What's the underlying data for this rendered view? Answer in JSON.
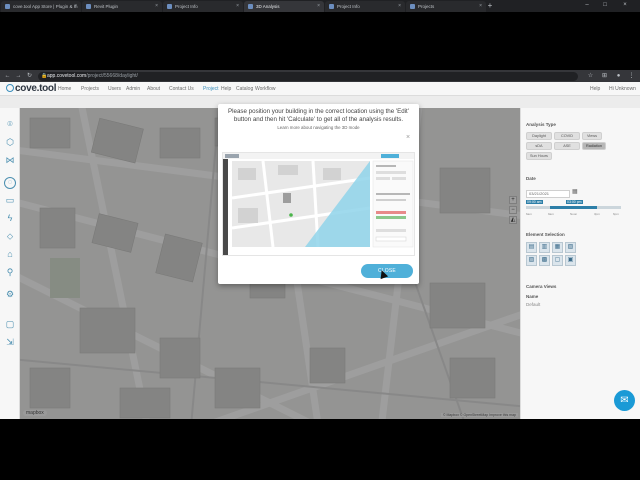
{
  "browser": {
    "tabs": [
      {
        "label": "cove.tool App Store | Plugin & In"
      },
      {
        "label": "Revit Plugin"
      },
      {
        "label": "Project Info"
      },
      {
        "label": "3D Analysis",
        "active": true
      },
      {
        "label": "Project Info"
      },
      {
        "label": "Projects"
      }
    ],
    "new_tab": "+",
    "url_host": "app.covetool.com",
    "url_path": "/project/55668/daylight/",
    "window_buttons": [
      "–",
      "□",
      "×"
    ]
  },
  "app": {
    "logo": "cove.tool",
    "nav": [
      "Home",
      "Projects",
      "Users",
      "Admin",
      "About",
      "Contact Us"
    ],
    "nav_project": [
      "Project",
      "Help",
      "Catalog",
      "Workflow"
    ],
    "help": "Help",
    "user": "Hi Unknown"
  },
  "left_tools": [
    "map-pin",
    "cube",
    "share",
    "circle",
    "folder",
    "bolt",
    "droplet",
    "tag",
    "person",
    "gear",
    "chat",
    "export"
  ],
  "map": {
    "attribution": "© Mapbox © OpenStreetMap Improve this map",
    "logo": "mapbox",
    "zoom_in": "+",
    "zoom_out": "−"
  },
  "right_panel": {
    "analysis_type_title": "Analysis Type",
    "analysis_types": [
      "Daylight",
      "COVID",
      "Views",
      "sDA",
      "ASE",
      "Radiation",
      "Sun Hours"
    ],
    "selected_analysis": "Radiation",
    "date_title": "Date",
    "date_value": "03/21/2021",
    "time_start": "09:00 am",
    "time_end": "03:00 pm",
    "time_ticks": [
      "6am",
      "9am",
      "Noon",
      "3pm",
      "6pm"
    ],
    "time_range_fraction": [
      0.25,
      0.75
    ],
    "element_selection_title": "Element Selection",
    "camera_views_title": "Camera Views",
    "name_label": "Name",
    "name_value": "Default"
  },
  "modal": {
    "line1": "Please position your building in the correct location using the 'Edit'",
    "line2": "button and then hit 'Calculate' to get all of the analysis results.",
    "link": "Learn more about navigating the 3D mode",
    "close_x": "×",
    "close_button": "CLOSE"
  },
  "chat_icon": "chat-bubble-icon"
}
